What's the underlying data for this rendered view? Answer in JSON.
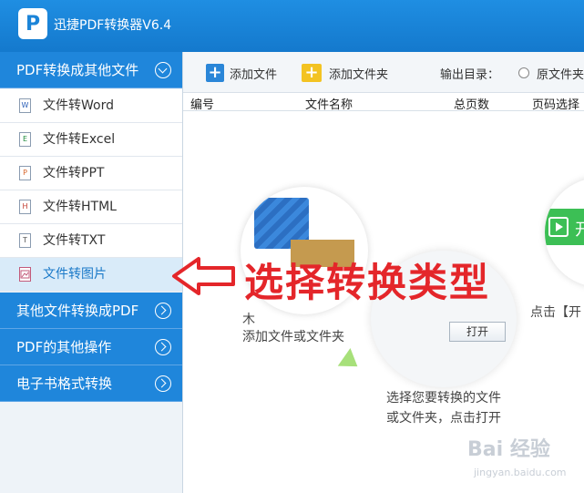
{
  "app": {
    "title": "迅捷PDF转换器V6.4",
    "logo_letter": "P"
  },
  "sidebar": {
    "categories": [
      {
        "label": "PDF转换成其他文件",
        "expanded": true
      },
      {
        "label": "其他文件转换成PDF",
        "expanded": false
      },
      {
        "label": "PDF的其他操作",
        "expanded": false
      },
      {
        "label": "电子书格式转换",
        "expanded": false
      }
    ],
    "items": [
      {
        "label": "文件转Word",
        "icon": "W"
      },
      {
        "label": "文件转Excel",
        "icon": "E"
      },
      {
        "label": "文件转PPT",
        "icon": "P"
      },
      {
        "label": "文件转HTML",
        "icon": "H"
      },
      {
        "label": "文件转TXT",
        "icon": "T"
      },
      {
        "label": "文件转图片",
        "icon": "image",
        "active": true
      }
    ]
  },
  "toolbar": {
    "add_file": "添加文件",
    "add_folder": "添加文件夹",
    "output_dir_label": "输出目录：",
    "output_option": "原文件夹"
  },
  "table": {
    "columns": [
      "编号",
      "文件名称",
      "总页数",
      "页码选择"
    ]
  },
  "guide": {
    "step1_partial": "木",
    "step1_text": "添加文件或文件夹",
    "step2_button": "打开",
    "step2_text": [
      "选择您要转换的文件",
      "或文件夹，点击打开"
    ],
    "step3_button": "开",
    "step3_text": "点击【开"
  },
  "annotation": {
    "text": "选择转换类型",
    "color": "#e4262a"
  },
  "watermark": {
    "text": "Bai 经验",
    "sub": "jingyan.baidu.com"
  },
  "colors": {
    "titlebar": "#1b84d8",
    "sidebar_category": "#1f86db",
    "accent_green": "#3cbf55"
  }
}
